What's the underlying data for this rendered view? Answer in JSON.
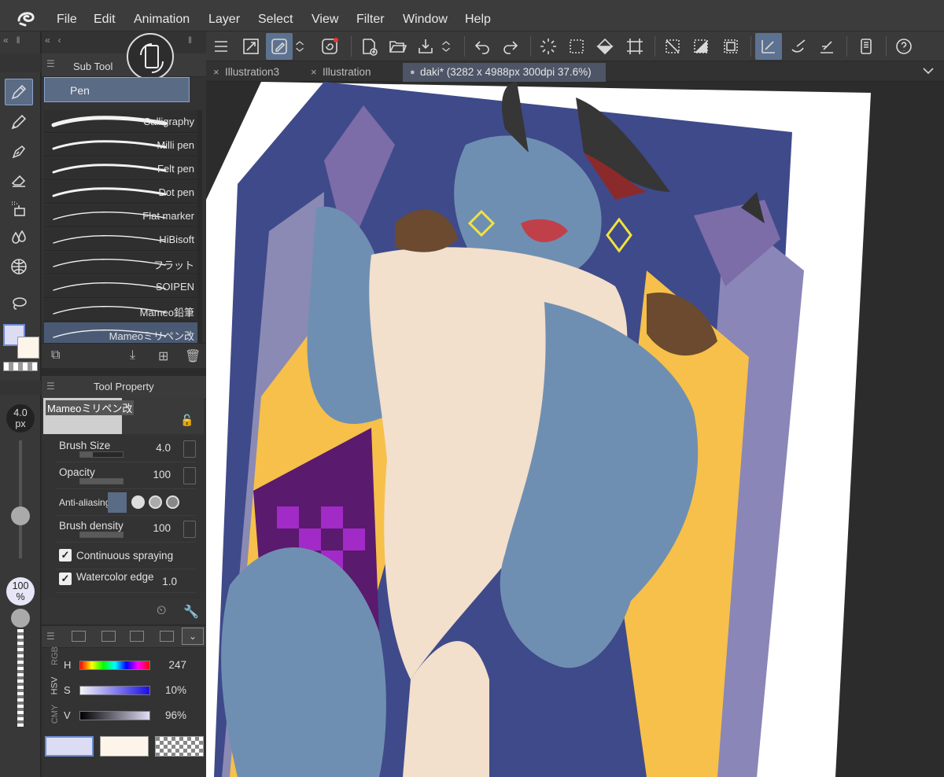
{
  "menu": [
    "File",
    "Edit",
    "Animation",
    "Layer",
    "Select",
    "View",
    "Filter",
    "Window",
    "Help"
  ],
  "doc_tabs": [
    {
      "label": "Illustration3",
      "marker": "×",
      "active": false
    },
    {
      "label": "Illustration",
      "marker": "×",
      "active": false
    },
    {
      "label": "daki* (3282 x 4988px 300dpi 37.6%)",
      "marker": "●",
      "active": true
    }
  ],
  "subtool": {
    "title": "Sub Tool",
    "group": "Pen",
    "brushes": [
      "Calligraphy",
      "Milli pen",
      "Felt pen",
      "Dot pen",
      "Flat marker",
      "HiBisoft",
      "フラット",
      "SOIPEN",
      "Mameo鉛筆",
      "Mameoミリペン改"
    ],
    "selected": "Mameoミリペン改"
  },
  "brush_size_indicator": {
    "value": "4.0",
    "unit": "px"
  },
  "opacity_indicator": {
    "value": "100",
    "unit": "%"
  },
  "tool_property": {
    "title": "Tool Property",
    "preset_name": "Mameoミリペン改",
    "brush_size": {
      "label": "Brush Size",
      "value": "4.0"
    },
    "opacity": {
      "label": "Opacity",
      "value": "100"
    },
    "anti_aliasing": {
      "label": "Anti-aliasing"
    },
    "brush_density": {
      "label": "Brush density",
      "value": "100"
    },
    "continuous_spraying": {
      "label": "Continuous spraying",
      "checked": true
    },
    "watercolor_edge": {
      "label": "Watercolor edge",
      "value": "1.0",
      "checked": true
    }
  },
  "color": {
    "mode_tabs": [
      "RGB",
      "HSV",
      "CMY"
    ],
    "h": {
      "label": "H",
      "value": "247"
    },
    "s": {
      "label": "S",
      "value": "10%"
    },
    "v": {
      "label": "V",
      "value": "96%"
    },
    "main_color": "#dcdcf5",
    "sub_color": "#fdf5ea"
  },
  "icons": [
    "app-logo-icon",
    "menu-icon",
    "fit-icon",
    "brush-edit-icon",
    "spiral-icon",
    "new-canvas-icon",
    "open-icon",
    "save-icon",
    "undo-icon",
    "redo-icon",
    "loading-icon",
    "select-all-icon",
    "fill-icon",
    "transform-icon",
    "deselect-icon",
    "invert-selection-icon",
    "border-icon",
    "pen-tool-icon",
    "pencil-icon",
    "marker-icon",
    "eraser-icon",
    "airbrush-icon",
    "blend-icon",
    "gradient-icon",
    "lasso-icon",
    "help-icon"
  ]
}
